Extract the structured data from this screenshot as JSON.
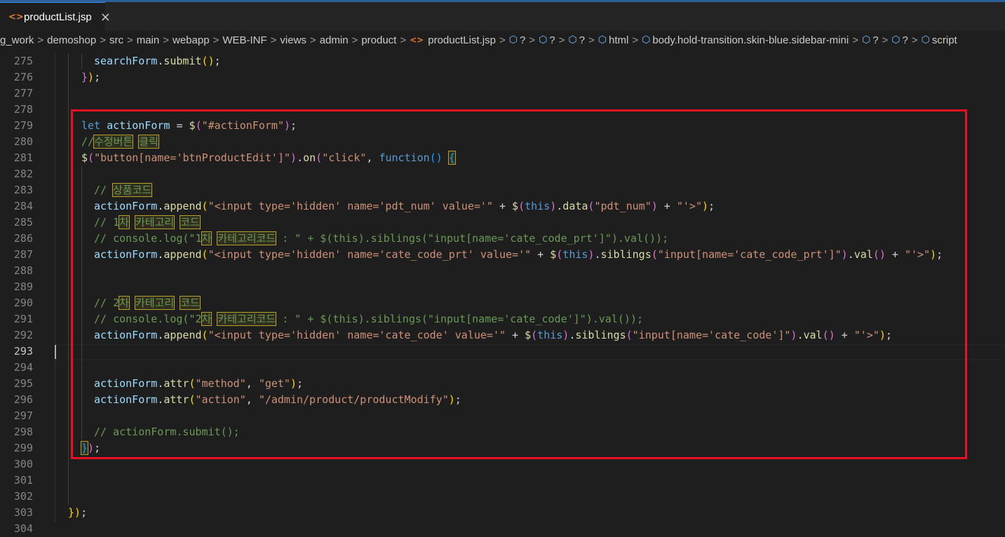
{
  "tab": {
    "file_icon": "<>",
    "name": "productList.jsp",
    "close_icon": "×"
  },
  "breadcrumb": {
    "path": [
      "g_work",
      "demoshop",
      "src",
      "main",
      "webapp",
      "WEB-INF",
      "views",
      "admin",
      "product"
    ],
    "file": "productList.jsp",
    "symbols": [
      "?",
      "?",
      "?",
      "html",
      "body.hold-transition.skin-blue.sidebar-mini",
      "?",
      "?",
      "script"
    ],
    "separator": ">",
    "file_icon": "<>",
    "symbol_icon": "cube-icon"
  },
  "editor": {
    "active_line": "293",
    "lines": [
      {
        "n": "275",
        "code": "searchForm.submit();"
      },
      {
        "n": "276",
        "code": "});"
      },
      {
        "n": "277",
        "code": ""
      },
      {
        "n": "278",
        "code": ""
      },
      {
        "n": "279",
        "code": "let actionForm = $(\"#actionForm\");"
      },
      {
        "n": "280",
        "code": "//수정버튼 클릭"
      },
      {
        "n": "281",
        "code": "$(\"button[name='btnProductEdit']\").on(\"click\", function() {"
      },
      {
        "n": "282",
        "code": ""
      },
      {
        "n": "283",
        "code": "// 상품코드"
      },
      {
        "n": "284",
        "code": "actionForm.append(\"<input type='hidden' name='pdt_num' value='\" + $(this).data(\"pdt_num\") + \"'>\");"
      },
      {
        "n": "285",
        "code": "// 1차 카테고리 코드"
      },
      {
        "n": "286",
        "code": "// console.log(\"1차 카테고리코드 : \" + $(this).siblings(\"input[name='cate_code_prt']\").val());"
      },
      {
        "n": "287",
        "code": "actionForm.append(\"<input type='hidden' name='cate_code_prt' value='\" + $(this).siblings(\"input[name='cate_code_prt']\").val() + \"'>\");"
      },
      {
        "n": "288",
        "code": ""
      },
      {
        "n": "289",
        "code": ""
      },
      {
        "n": "290",
        "code": "// 2차 카테고리 코드"
      },
      {
        "n": "291",
        "code": "// console.log(\"2차 카테고리코드 : \" + $(this).siblings(\"input[name='cate_code']\").val());"
      },
      {
        "n": "292",
        "code": "actionForm.append(\"<input type='hidden' name='cate_code' value='\" + $(this).siblings(\"input[name='cate_code']\").val() + \"'>\");"
      },
      {
        "n": "293",
        "code": ""
      },
      {
        "n": "294",
        "code": ""
      },
      {
        "n": "295",
        "code": "actionForm.attr(\"method\", \"get\");"
      },
      {
        "n": "296",
        "code": "actionForm.attr(\"action\", \"/admin/product/productModify\");"
      },
      {
        "n": "297",
        "code": ""
      },
      {
        "n": "298",
        "code": "// actionForm.submit();"
      },
      {
        "n": "299",
        "code": "});"
      },
      {
        "n": "300",
        "code": ""
      },
      {
        "n": "301",
        "code": ""
      },
      {
        "n": "302",
        "code": ""
      },
      {
        "n": "303",
        "code": "});"
      },
      {
        "n": "304",
        "code": ""
      }
    ]
  },
  "colors": {
    "background": "#1e1e1e",
    "keyword": "#569cd6",
    "variable": "#9cdcfe",
    "function": "#dcdcaa",
    "string": "#ce9178",
    "comment": "#6a9955",
    "bracket_level1": "#ffd700",
    "bracket_level2": "#da70d6",
    "bracket_level3": "#179fff",
    "annotation_box": "#e81123"
  }
}
